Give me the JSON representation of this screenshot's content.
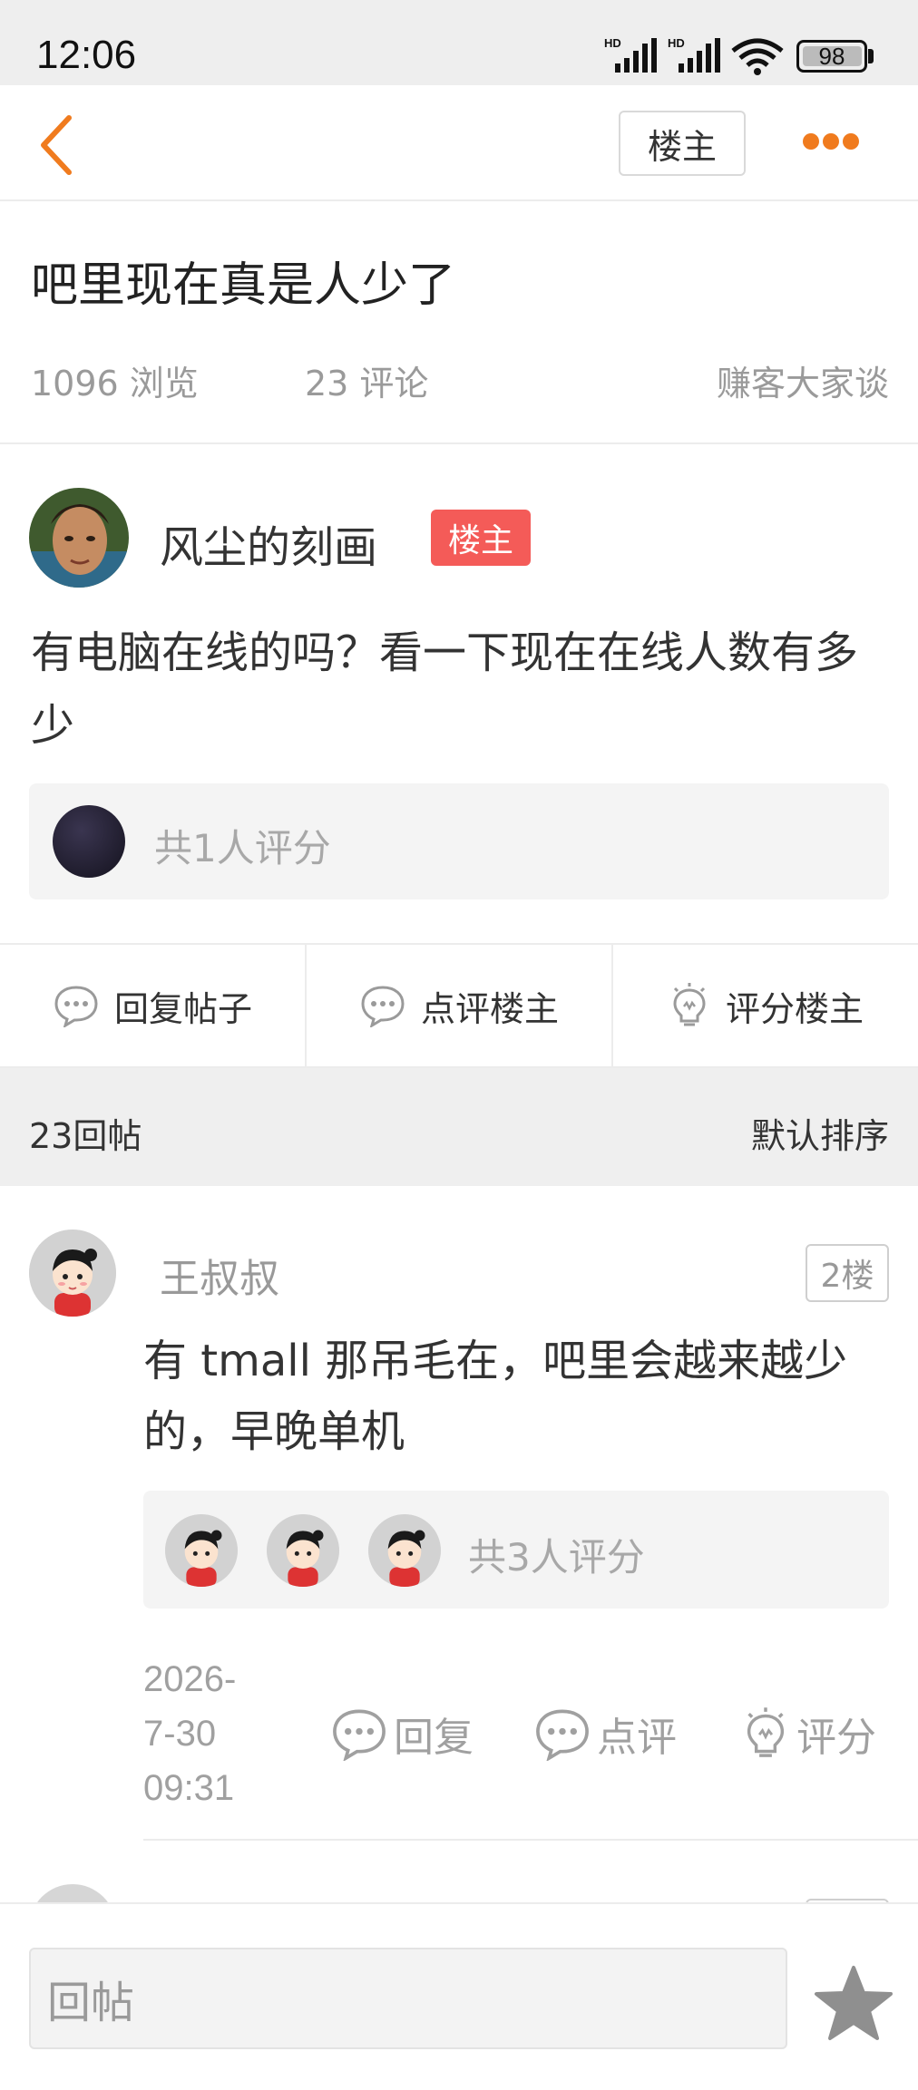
{
  "status_bar": {
    "time": "12:06",
    "battery": "98",
    "battery_level_percent": 98,
    "icons": [
      "hd-signal-icon",
      "hd-signal-icon",
      "wifi-icon",
      "battery-icon"
    ]
  },
  "header": {
    "back_icon": "chevron-left-icon",
    "owner_only_label": "楼主",
    "more_icon": "more-dots-icon",
    "accent_color": "#f07b1e"
  },
  "post": {
    "title": "吧里现在真是人少了",
    "views": "1096 浏览",
    "comments": "23 评论",
    "forum": "赚客大家谈",
    "author": "风尘的刻画",
    "author_badge": "楼主",
    "badge_color": "#f45b58",
    "body": "有电脑在线的吗？看一下现在在线人数有多少",
    "rating_summary": "共1人评分"
  },
  "actions": [
    {
      "label": "回复帖子",
      "icon": "comment-bubble-icon"
    },
    {
      "label": "点评楼主",
      "icon": "comment-bubble-icon"
    },
    {
      "label": "评分楼主",
      "icon": "lightbulb-icon"
    }
  ],
  "replies_bar": {
    "count_label": "23回帖",
    "sort_label": "默认排序"
  },
  "reply": {
    "user": "王叔叔",
    "floor": "2楼",
    "body": "有 tmall 那吊毛在，吧里会越来越少的，早晚单机",
    "rating_summary": "共3人评分",
    "date_line1": "2026-",
    "date_line2": "7-30",
    "date_line3": "09:31",
    "reply_label": "回复",
    "comment_label": "点评",
    "rate_label": "评分"
  },
  "bottom_bar": {
    "placeholder": "回帖",
    "favorite_icon": "star-icon"
  }
}
